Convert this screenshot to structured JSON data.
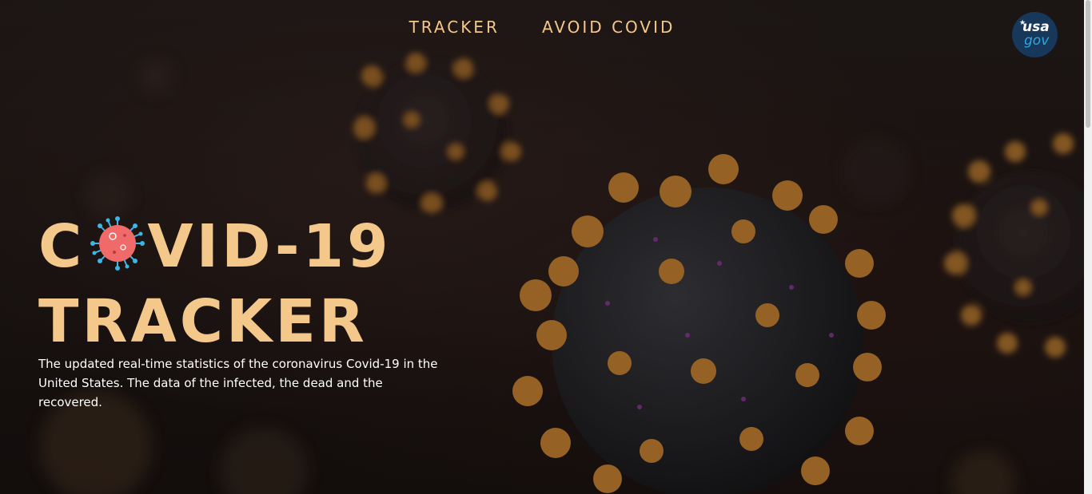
{
  "nav": {
    "items": [
      {
        "label": "TRACKER"
      },
      {
        "label": "AVOID COVID"
      }
    ]
  },
  "logo": {
    "line1": "usa",
    "line2": "gov"
  },
  "hero": {
    "title_part1": "C",
    "title_part2": "VID-19",
    "title_line2": "TRACKER",
    "description": "The updated real-time statistics of the coronavirus Covid-19 in the United States. The data of the infected, the dead and the recovered."
  },
  "colors": {
    "accent": "#f3c88a",
    "virus_icon": "#f06a6a",
    "logo_bg": "#17375b",
    "logo_gov": "#2ea8e0"
  }
}
